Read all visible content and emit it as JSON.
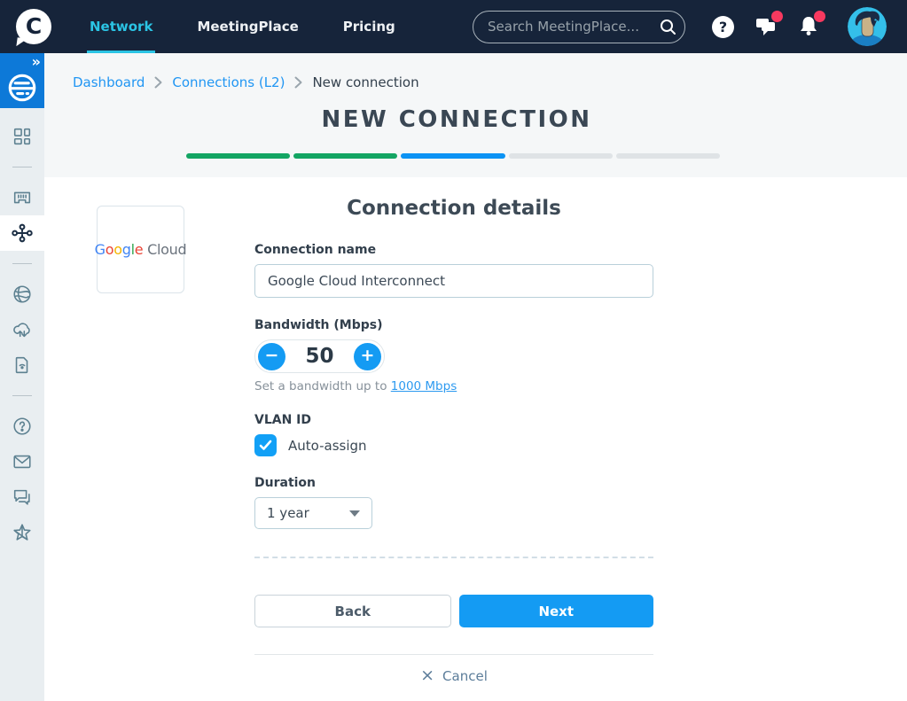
{
  "nav": {
    "brand": "C",
    "items": [
      {
        "label": "Network",
        "active": true
      },
      {
        "label": "MeetingPlace",
        "active": false
      },
      {
        "label": "Pricing",
        "active": false
      }
    ],
    "search_placeholder": "Search MeetingPlace...",
    "help_glyph": "?",
    "badges": {
      "messages": true,
      "notifications": true
    }
  },
  "sidebar": {
    "expand_glyph": "»",
    "icons": [
      "network-logo-icon",
      "dashboard-icon",
      "ports-icon",
      "connections-icon",
      "internet-icon",
      "cloud-exchange-icon",
      "iot-sim-icon",
      "help-icon",
      "contact-icon",
      "feedback-icon",
      "whats-new-icon"
    ],
    "active_icon": "connections-icon"
  },
  "breadcrumb": [
    "Dashboard",
    "Connections (L2)",
    "New connection"
  ],
  "page": {
    "title": "NEW CONNECTION"
  },
  "progress": {
    "segments": [
      "done",
      "done",
      "current",
      "todo",
      "todo"
    ]
  },
  "form": {
    "heading": "Connection details",
    "provider": {
      "letters": [
        "G",
        "o",
        "o",
        "g",
        "l",
        "e"
      ],
      "suffix": " Cloud"
    },
    "connection_name": {
      "label": "Connection name",
      "value": "Google Cloud Interconnect"
    },
    "bandwidth": {
      "label": "Bandwidth (Mbps)",
      "value": "50",
      "minus_glyph": "−",
      "plus_glyph": "+",
      "helper_prefix": "Set a bandwidth up to ",
      "helper_link": "1000 Mbps"
    },
    "vlan": {
      "label": "VLAN ID",
      "checkbox_label": "Auto-assign",
      "checked": true
    },
    "duration": {
      "label": "Duration",
      "value": "1 year"
    },
    "actions": {
      "back": "Back",
      "next": "Next",
      "cancel": "Cancel",
      "cancel_glyph": "×"
    }
  },
  "colors": {
    "navbar_navy": "#16243a",
    "accent_cyan": "#2bc4e4",
    "primary_blue": "#149bf3",
    "success_green": "#13a563",
    "badge_pink": "#f8395f",
    "sidebar_blue": "#0d79d8",
    "link_blue": "#2196f3"
  }
}
